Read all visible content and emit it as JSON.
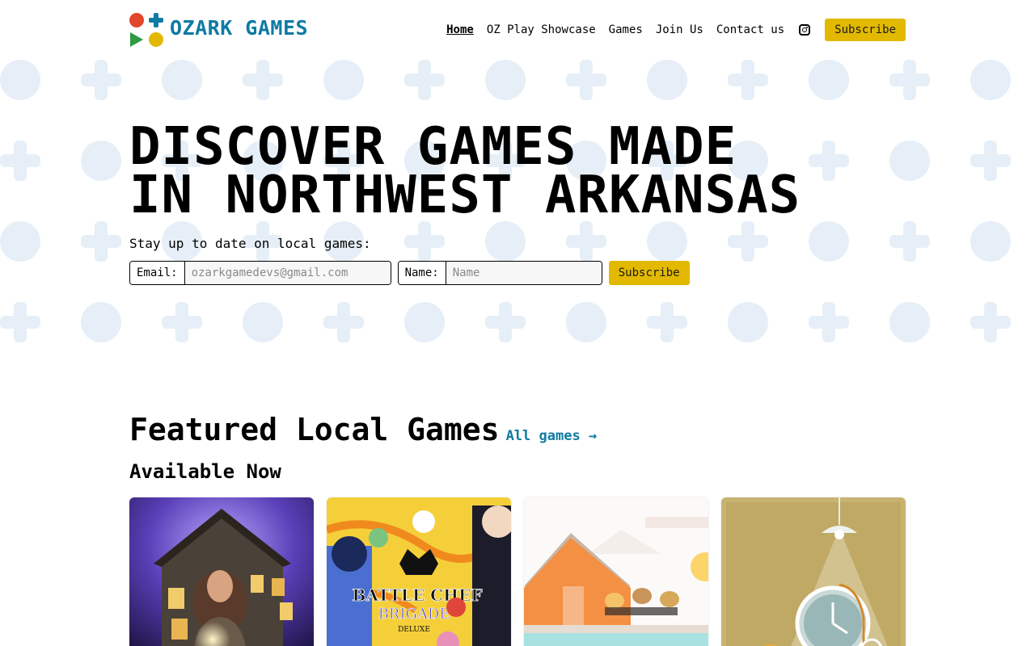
{
  "header": {
    "logo_text": "OZARK GAMES",
    "nav": [
      {
        "label": "Home",
        "active": true
      },
      {
        "label": "OZ Play Showcase"
      },
      {
        "label": "Games"
      },
      {
        "label": "Join Us"
      },
      {
        "label": "Contact us"
      }
    ],
    "instagram_icon": "instagram-icon",
    "subscribe_label": "Subscribe"
  },
  "hero": {
    "title_line1": "DISCOVER GAMES MADE",
    "title_line2": "IN NORTHWEST ARKANSAS",
    "subtitle": "Stay up to date on local games:",
    "email_label": "Email:",
    "email_placeholder": "ozarkgamedevs@gmail.com",
    "name_label": "Name:",
    "name_placeholder": "Name",
    "subscribe_label": "Subscribe"
  },
  "featured": {
    "title": "Featured Local Games",
    "all_games_link": "All games →",
    "section_title": "Available Now",
    "cards": [
      {
        "art": "haunted-house-art"
      },
      {
        "art": "battle-chef-brigade-art",
        "logo_line1": "BATTLE CHEF",
        "logo_line2": "BRIGADE",
        "logo_line3": "DELUXE"
      },
      {
        "art": "orange-house-art"
      },
      {
        "art": "clock-bicycle-art"
      }
    ]
  },
  "colors": {
    "brand_blue": "#0f7ba3",
    "accent_yellow": "#e2b900",
    "logo_red": "#e2462b",
    "logo_green": "#2d9a45",
    "pattern": "#e6eff7"
  }
}
